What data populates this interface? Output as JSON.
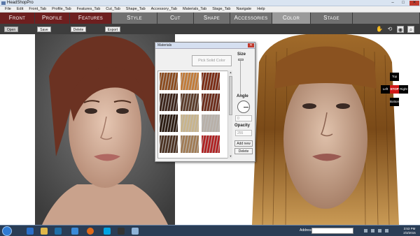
{
  "window": {
    "title": "HeadShopPro",
    "controls": {
      "minimize": "–",
      "maximize": "□",
      "close": "✕"
    }
  },
  "menubar": {
    "items": [
      "File",
      "Edit",
      "Front_Tab",
      "Profile_Tab",
      "Features_Tab",
      "Cut_Tab",
      "Shape_Tab",
      "Accessory_Tab",
      "Materials_Tab",
      "Stage_Tab",
      "Navigate",
      "Help"
    ]
  },
  "tabs": [
    {
      "label": "Front",
      "style": "dark"
    },
    {
      "label": "Profile",
      "style": "dark"
    },
    {
      "label": "Features",
      "style": "dark"
    },
    {
      "label": "Style",
      "style": "grey"
    },
    {
      "label": "Cut",
      "style": "grey"
    },
    {
      "label": "Shape",
      "style": "grey"
    },
    {
      "label": "Accessories",
      "style": "grey"
    },
    {
      "label": "Color",
      "style": "active"
    },
    {
      "label": "Stage",
      "style": "grey"
    }
  ],
  "toolbar": {
    "open_label": "Open",
    "save_label": "Save",
    "delete_label": "Delete",
    "export_label": "Export",
    "icons": [
      "hand-icon",
      "rotate-icon",
      "camera-icon",
      "zoom-icon"
    ]
  },
  "materials_window": {
    "title": "Materials",
    "close": "✕",
    "solid_color_button": "Pick Solid Color",
    "swatches": [
      "#8b4a1c",
      "#c27a36",
      "#7a2a12",
      "#3a2218",
      "#5a3a28",
      "#6b2a18",
      "#2a1a10",
      "#c9b48a",
      "#b8b0a8",
      "#4a3020",
      "#a07a52",
      "#b02020"
    ],
    "size_label": "Size",
    "angle_label": "Angle",
    "angle_value": "0",
    "opacity_label": "Opacity",
    "opacity_value": "255",
    "add_new_label": "Add new",
    "delete_label": "Delete"
  },
  "navpad": {
    "top": "Top",
    "left": "Left",
    "stop": "STOP",
    "right": "Right",
    "bottom": "Bottom"
  },
  "taskbar": {
    "address_label": "Address",
    "time": "3:53 PM",
    "date": "2/3/2015"
  }
}
